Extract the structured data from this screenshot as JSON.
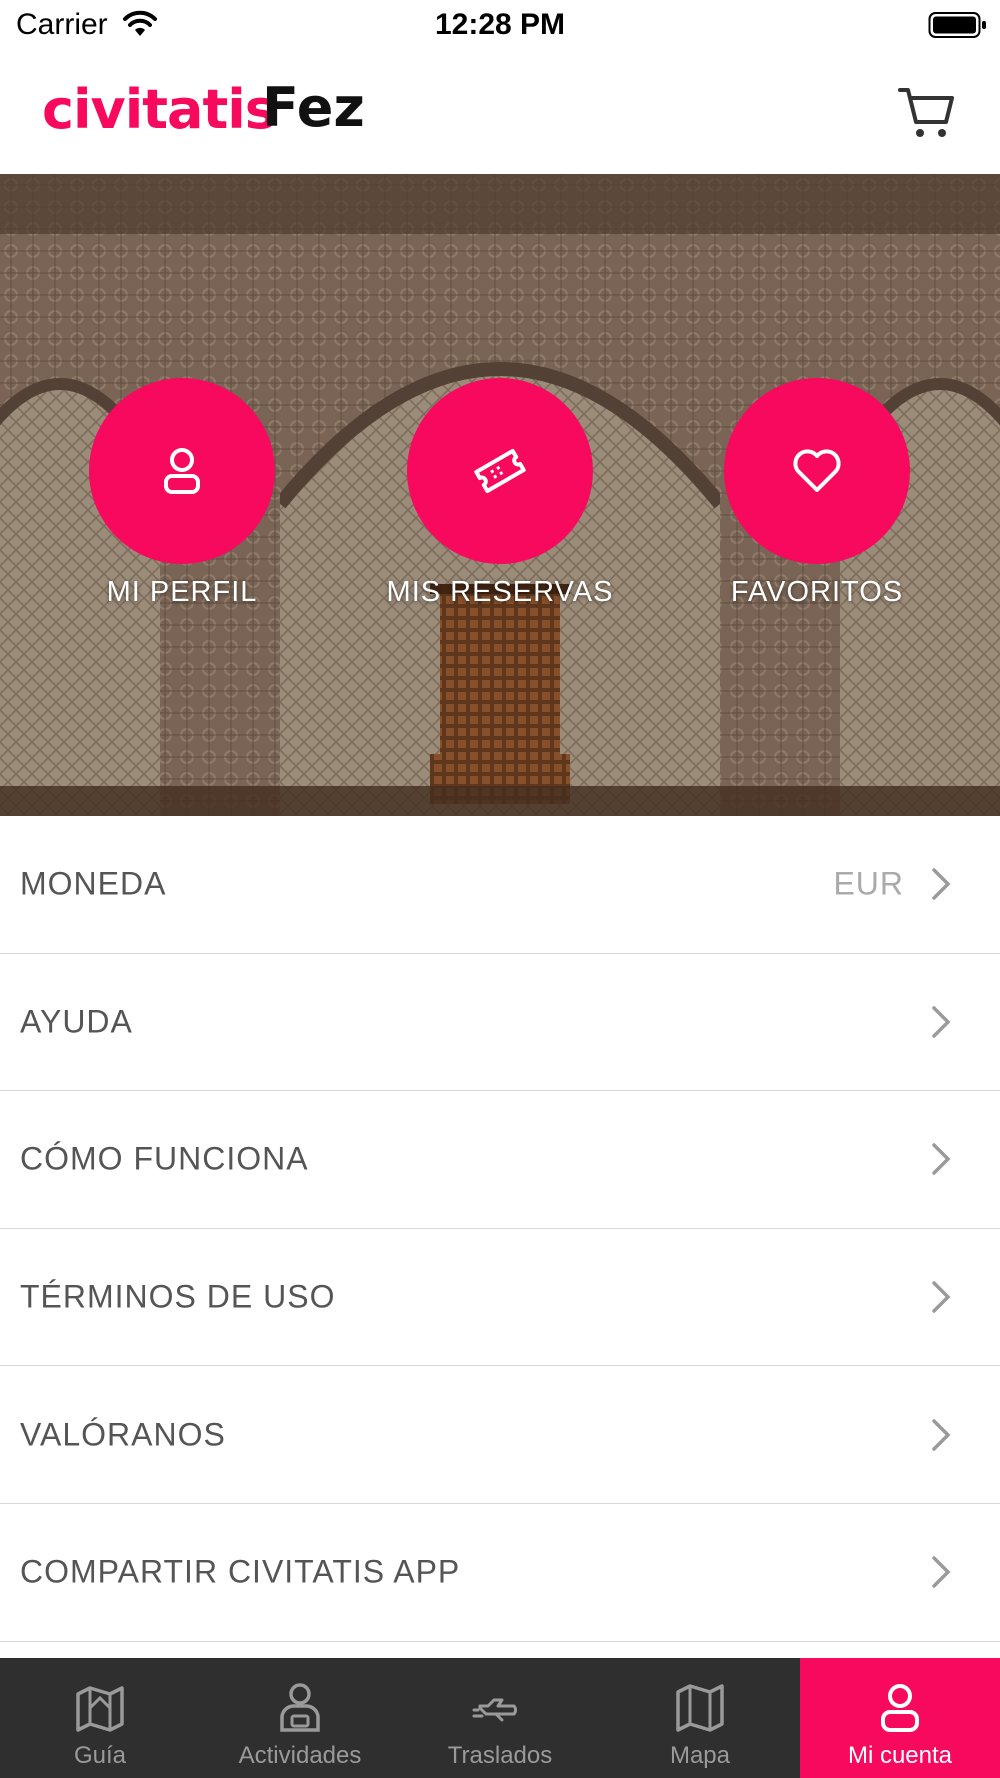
{
  "status_bar": {
    "carrier": "Carrier",
    "time": "12:28 PM"
  },
  "header": {
    "brand": "civitatis",
    "city": "Fez",
    "cart_icon": "cart-icon"
  },
  "colors": {
    "accent": "#f70a5e",
    "tab_bar": "#2f2f2f",
    "menu_text": "#555555",
    "divider": "#d8d8d8"
  },
  "quick_actions": [
    {
      "label": "MI PERFIL",
      "icon": "user-icon"
    },
    {
      "label": "MIS RESERVAS",
      "icon": "ticket-icon"
    },
    {
      "label": "FAVORITOS",
      "icon": "heart-icon"
    }
  ],
  "menu": [
    {
      "label": "MONEDA",
      "value": "EUR"
    },
    {
      "label": "AYUDA"
    },
    {
      "label": "CÓMO FUNCIONA"
    },
    {
      "label": "TÉRMINOS DE USO"
    },
    {
      "label": "VALÓRANOS"
    },
    {
      "label": "COMPARTIR CIVITATIS APP"
    }
  ],
  "tabs": [
    {
      "label": "Guía",
      "icon": "guide-map-icon",
      "active": false
    },
    {
      "label": "Actividades",
      "icon": "activities-icon",
      "active": false
    },
    {
      "label": "Traslados",
      "icon": "transfer-plane-icon",
      "active": false
    },
    {
      "label": "Mapa",
      "icon": "map-icon",
      "active": false
    },
    {
      "label": "Mi cuenta",
      "icon": "account-icon",
      "active": true
    }
  ]
}
